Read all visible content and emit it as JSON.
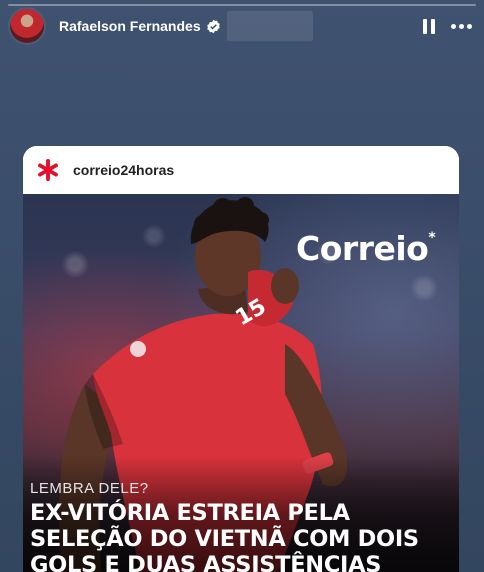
{
  "story": {
    "progress_fraction": 0.0
  },
  "header": {
    "username": "Rafaelson Fernandes",
    "verified_icon": "verified-badge-icon",
    "pause_icon": "pause-icon",
    "more_icon": "more-options-icon"
  },
  "post": {
    "account": "correio24horas",
    "logo_icon": "asterisk-logo-icon",
    "logo_color": "#e3102c",
    "brand_text": "Correio",
    "brand_mark": "*",
    "kicker": "LEMBRA DELE?",
    "headline_lines": [
      "EX-VITÓRIA ESTREIA PELA",
      "SELEÇÃO DO VIETNÃ COM DOIS",
      "GOLS E DUAS ASSISTÊNCIAS"
    ],
    "jersey_color": "#d8333c"
  }
}
